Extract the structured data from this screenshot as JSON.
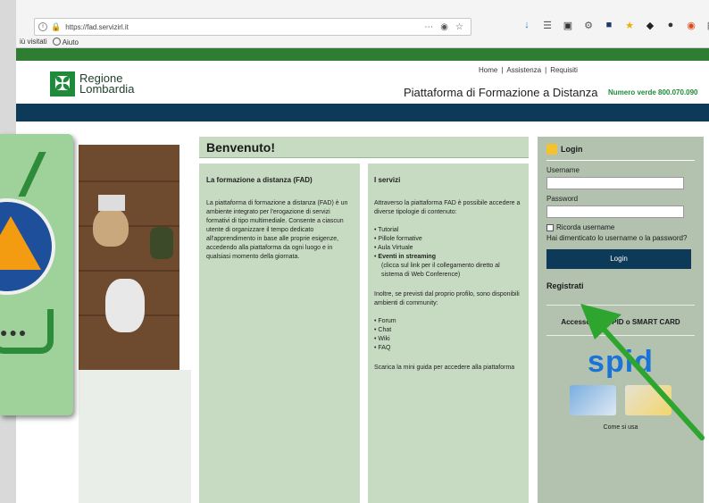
{
  "browser": {
    "url": "https://fad.servizirl.it",
    "bookmarks": [
      "iù visitati",
      "Aiuto"
    ]
  },
  "header": {
    "logo_line1": "Regione",
    "logo_line2": "Lombardia",
    "links": [
      "Home",
      "|",
      "Assistenza",
      "|",
      "Requisiti"
    ],
    "site_title": "Piattaforma di Formazione a Distanza",
    "phone": "Numero verde 800.070.090"
  },
  "main": {
    "welcome": "Benvenuto!",
    "fad": {
      "title": "La formazione a distanza (FAD)",
      "body": "La piattaforma di formazione a distanza (FAD) è un ambiente integrato per l'erogazione di servizi formativi di tipo multimediale. Consente a ciascun utente di organizzare il tempo dedicato all'apprendimento in base alle proprie esigenze, accedendo alla piattaforma da ogni luogo e in qualsiasi momento della giornata."
    },
    "servizi": {
      "title": "I servizi",
      "intro": "Attraverso la piattaforma FAD è possibile accedere a diverse tipologie di contenuto:",
      "items": [
        "Tutorial",
        "Pillole formative",
        "Aula Virtuale"
      ],
      "streaming_title": "Eventi in streaming",
      "streaming_note": "(clicca sul link per il collegamento diretto al sistema di Web Conference)",
      "community_intro": "Inoltre, se previsti dal proprio profilo, sono disponibili ambienti di community:",
      "community": [
        "Forum",
        "Chat",
        "Wiki",
        "FAQ"
      ],
      "guide": "Scarica la mini guida per accedere alla piattaforma"
    }
  },
  "login": {
    "title": "Login",
    "username_label": "Username",
    "password_label": "Password",
    "remember": "Ricorda username",
    "forgot": "Hai dimenticato lo username o la password?",
    "button": "Login",
    "register": "Registrati",
    "spid_access": "Accesso con SPID o SMART CARD",
    "spid_logo": "spid",
    "how_to": "Come si usa"
  },
  "colors": {
    "brand_green": "#2e7d32",
    "navy": "#0e3a59",
    "panel_green": "#c7dbc2",
    "arrow_green": "#2ea52e"
  }
}
